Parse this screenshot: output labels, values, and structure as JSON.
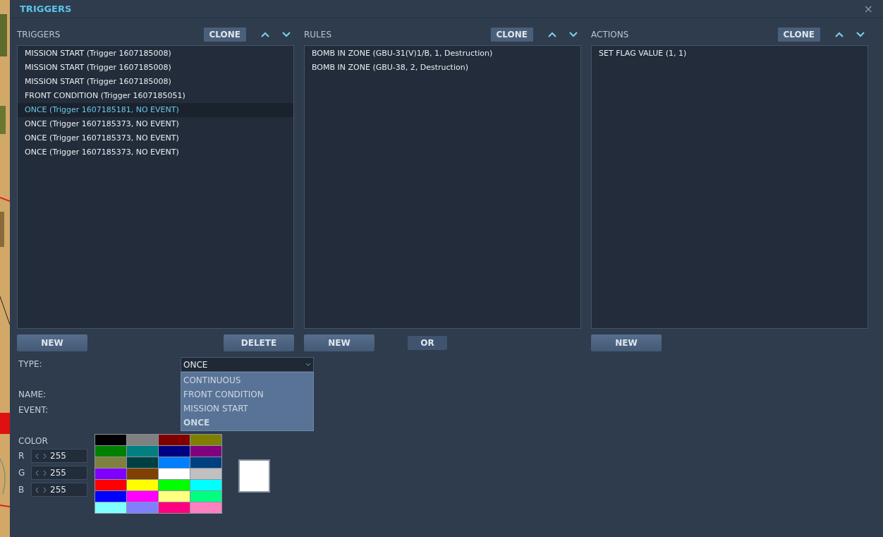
{
  "window": {
    "title": "TRIGGERS",
    "close": "×"
  },
  "panels": [
    {
      "label": "TRIGGERS",
      "clone": "CLONE",
      "items": [
        {
          "text": "MISSION START (Trigger 1607185008)",
          "selected": false
        },
        {
          "text": "MISSION START (Trigger 1607185008)",
          "selected": false
        },
        {
          "text": "MISSION START (Trigger 1607185008)",
          "selected": false
        },
        {
          "text": "FRONT CONDITION (Trigger 1607185051)",
          "selected": false
        },
        {
          "text": "ONCE (Trigger 1607185181, NO EVENT)",
          "selected": true
        },
        {
          "text": "ONCE (Trigger 1607185373, NO EVENT)",
          "selected": false
        },
        {
          "text": "ONCE (Trigger 1607185373, NO EVENT)",
          "selected": false
        },
        {
          "text": "ONCE (Trigger 1607185373, NO EVENT)",
          "selected": false
        }
      ],
      "buttons": [
        {
          "label": "NEW",
          "kind": "wide"
        },
        {
          "label": "DELETE",
          "kind": "wide"
        }
      ]
    },
    {
      "label": "RULES",
      "clone": "CLONE",
      "items": [
        {
          "text": "BOMB IN ZONE (GBU-31(V)1/B, 1, Destruction)",
          "selected": false
        },
        {
          "text": "BOMB IN ZONE (GBU-38, 2, Destruction)",
          "selected": false
        }
      ],
      "buttons": [
        {
          "label": "NEW",
          "kind": "wide"
        },
        {
          "label": "OR",
          "kind": "small"
        }
      ]
    },
    {
      "label": "ACTIONS",
      "clone": "CLONE",
      "items": [
        {
          "text": "SET FLAG VALUE (1, 1)",
          "selected": false
        }
      ],
      "buttons": [
        {
          "label": "NEW",
          "kind": "wide"
        }
      ]
    }
  ],
  "type": {
    "label": "TYPE:",
    "value": "ONCE",
    "options": [
      {
        "text": "CONTINUOUS",
        "selected": false
      },
      {
        "text": "FRONT CONDITION",
        "selected": false
      },
      {
        "text": "MISSION START",
        "selected": false
      },
      {
        "text": "ONCE",
        "selected": true
      }
    ]
  },
  "name": {
    "label": "NAME:"
  },
  "event": {
    "label": "EVENT:"
  },
  "color": {
    "label": "COLOR",
    "channels": [
      {
        "label": "R",
        "value": "255"
      },
      {
        "label": "G",
        "value": "255"
      },
      {
        "label": "B",
        "value": "255"
      }
    ],
    "swatches": [
      {
        "color": "#000000"
      },
      {
        "color": "#808080"
      },
      {
        "color": "#800000"
      },
      {
        "color": "#808000"
      },
      {
        "color": "#008000"
      },
      {
        "color": "#008080"
      },
      {
        "color": "#000080"
      },
      {
        "color": "#800080"
      },
      {
        "color": "#808040"
      },
      {
        "color": "#004040"
      },
      {
        "color": "#0080ff"
      },
      {
        "color": "#004080"
      },
      {
        "color": "#8000ff"
      },
      {
        "color": "#804000"
      },
      {
        "color": "#ffffff"
      },
      {
        "color": "#c0c0c0"
      },
      {
        "color": "#ff0000"
      },
      {
        "color": "#ffff00"
      },
      {
        "color": "#00ff00"
      },
      {
        "color": "#00ffff"
      },
      {
        "color": "#0000ff"
      },
      {
        "color": "#ff00ff"
      },
      {
        "color": "#ffff80"
      },
      {
        "color": "#00ff80"
      },
      {
        "color": "#80ffff"
      },
      {
        "color": "#8080ff"
      },
      {
        "color": "#ff0080"
      },
      {
        "color": "#ff80c0"
      }
    ],
    "preview": {
      "color": "#ffffff"
    }
  }
}
